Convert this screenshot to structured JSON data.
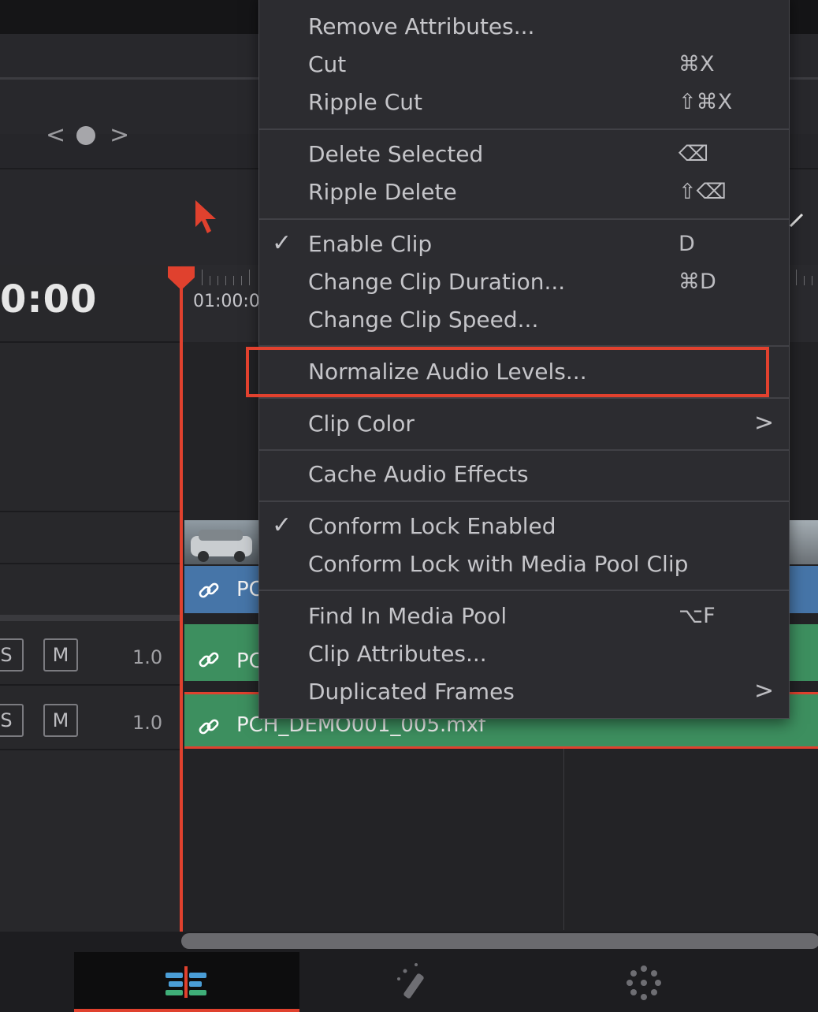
{
  "timecode": "0:00",
  "ruler_timecode": "01:00:0",
  "nav": {
    "prev": "<",
    "next": ">"
  },
  "tracks": [
    {
      "solo": "S",
      "mute": "M",
      "volume": "1.0"
    },
    {
      "solo": "S",
      "mute": "M",
      "volume": "1.0"
    }
  ],
  "clips": {
    "video_label": "PC",
    "audio1_label": "PC",
    "audio2_label": "PCH_DEMO001_005.mxf"
  },
  "menu": {
    "items": [
      {
        "label": "Remove Attributes...",
        "shortcut": ""
      },
      {
        "label": "Cut",
        "shortcut": "⌘X"
      },
      {
        "label": "Ripple Cut",
        "shortcut": "⇧⌘X"
      },
      {
        "label": "Delete Selected",
        "shortcut": "⌫"
      },
      {
        "label": "Ripple Delete",
        "shortcut": "⇧⌫"
      },
      {
        "label": "Enable Clip",
        "shortcut": "D",
        "checked": true
      },
      {
        "label": "Change Clip Duration...",
        "shortcut": "⌘D"
      },
      {
        "label": "Change Clip Speed...",
        "shortcut": ""
      },
      {
        "label": "Normalize Audio Levels...",
        "shortcut": "",
        "highlighted": true
      },
      {
        "label": "Clip Color",
        "shortcut": "",
        "submenu": true
      },
      {
        "label": "Cache Audio Effects",
        "shortcut": ""
      },
      {
        "label": "Conform Lock Enabled",
        "shortcut": "",
        "checked": true
      },
      {
        "label": "Conform Lock with Media Pool Clip",
        "shortcut": ""
      },
      {
        "label": "Find In Media Pool",
        "shortcut": "⌥F"
      },
      {
        "label": "Clip Attributes...",
        "shortcut": ""
      },
      {
        "label": "Duplicated Frames",
        "shortcut": "",
        "submenu": true
      }
    ],
    "check_glyph": "✓",
    "chevron_glyph": ">"
  },
  "colors": {
    "accent": "#e0412e",
    "video_clip": "#4675a8",
    "audio_clip": "#3d8f5f"
  },
  "bottom_tabs": [
    "edit-page-icon",
    "fusion-effects-icon",
    "color-page-icon"
  ]
}
